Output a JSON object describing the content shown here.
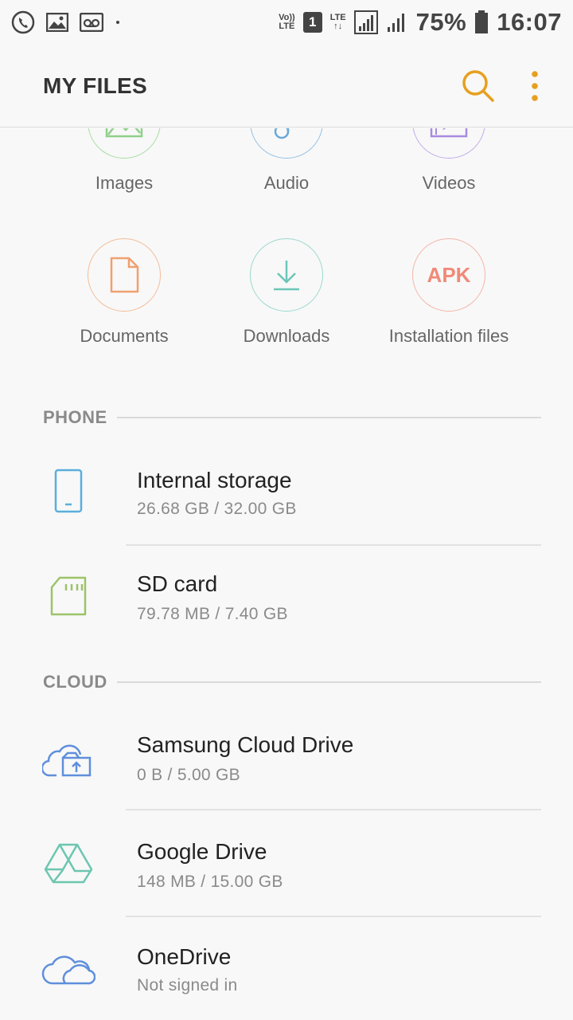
{
  "status_bar": {
    "volte_top": "Vo))",
    "volte_bottom": "LTE",
    "sim": "1",
    "lte": "LTE",
    "battery": "75%",
    "time": "16:07"
  },
  "app_bar": {
    "title": "MY FILES"
  },
  "categories": [
    {
      "label": "Images",
      "icon": "image-icon",
      "color": "#8fd08a"
    },
    {
      "label": "Audio",
      "icon": "music-note-icon",
      "color": "#6aa8d8"
    },
    {
      "label": "Videos",
      "icon": "video-icon",
      "color": "#a88be0"
    },
    {
      "label": "Documents",
      "icon": "document-icon",
      "color": "#f0a070"
    },
    {
      "label": "Downloads",
      "icon": "download-icon",
      "color": "#6cc6b8"
    },
    {
      "label": "Installation files",
      "icon": "apk-icon",
      "icon_text": "APK",
      "color": "#f08a78"
    }
  ],
  "sections": {
    "phone": "PHONE",
    "cloud": "CLOUD"
  },
  "storage": [
    {
      "name": "Internal storage",
      "detail": "26.68 GB / 32.00 GB",
      "icon": "phone-icon",
      "color": "#5aaedb"
    },
    {
      "name": "SD card",
      "detail": "79.78 MB / 7.40 GB",
      "icon": "sd-card-icon",
      "color": "#9cc36a"
    },
    {
      "name": "Samsung Cloud Drive",
      "detail": "0 B / 5.00 GB",
      "icon": "cloud-upload-icon",
      "color": "#5f8fdc"
    },
    {
      "name": "Google Drive",
      "detail": "148 MB / 15.00 GB",
      "icon": "google-drive-icon",
      "color": "#6cc6b0"
    },
    {
      "name": "OneDrive",
      "detail": "Not signed in",
      "icon": "onedrive-icon",
      "color": "#5f8fdc"
    }
  ]
}
